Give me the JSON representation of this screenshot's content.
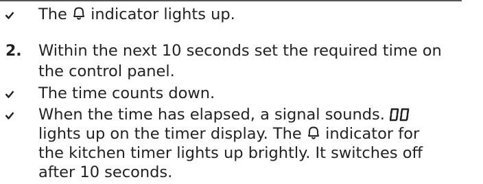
{
  "step1": {
    "result": {
      "before": "The",
      "after": "indicator lights up."
    }
  },
  "step2": {
    "number": "2.",
    "lines": [
      "Within the next 10 seconds set the required time on",
      "the control panel."
    ]
  },
  "results": [
    {
      "lines": [
        "The time counts down."
      ]
    },
    {
      "line1": "When the time has elapsed, a signal sounds.",
      "display_value": "00",
      "line2_before": "lights up on the timer display. The",
      "line2_after": "indicator for",
      "line3": "the kitchen timer lights up brightly. It switches off",
      "line4": "after 10 seconds."
    }
  ],
  "icons": {
    "result_marker": "check-icon",
    "indicator": "bell-icon",
    "display": "seven-segment-display"
  }
}
